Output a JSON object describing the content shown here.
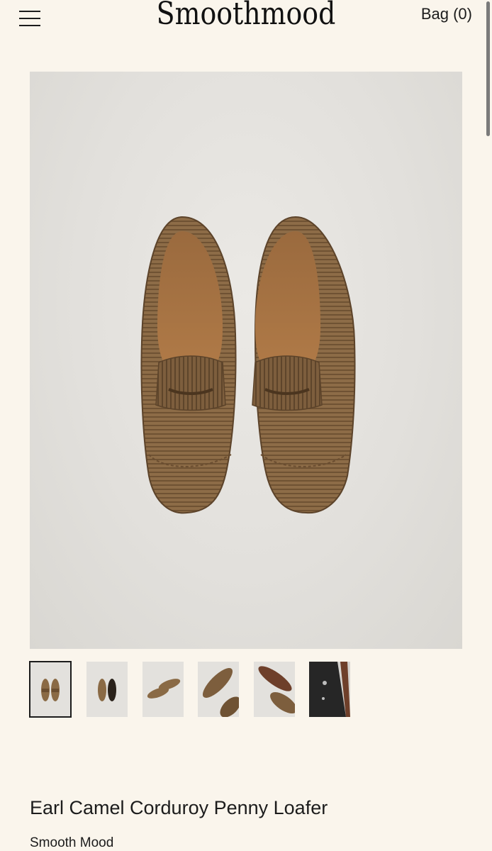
{
  "header": {
    "logo_text": "Smoothmood",
    "bag_label": "Bag (0)"
  },
  "product": {
    "title": "Earl Camel Corduroy Penny Loafer",
    "brand": "Smooth Mood"
  },
  "gallery": {
    "thumbnail_count": 6,
    "selected_index": 0
  },
  "colors": {
    "background": "#faf5ec",
    "photo_background": "#e4e2de",
    "loafer_camel": "#8a6a45",
    "text": "#1c1c1c"
  },
  "icons": [
    "menu-icon"
  ]
}
